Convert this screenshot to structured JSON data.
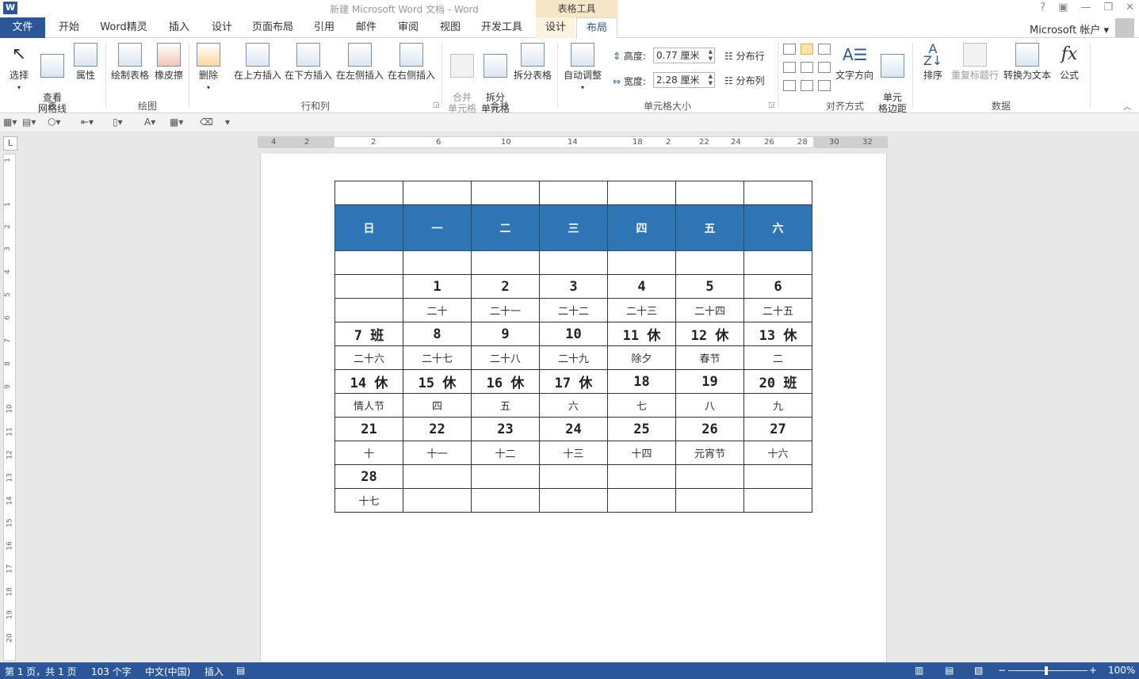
{
  "window": {
    "title": "新建 Microsoft Word 文档 - Word",
    "context_group": "表格工具",
    "controls": [
      "?",
      "▣",
      "—",
      "❐",
      "✕"
    ]
  },
  "tabs": [
    "文件",
    "开始",
    "Word精灵",
    "插入",
    "设计",
    "页面布局",
    "引用",
    "邮件",
    "审阅",
    "视图",
    "开发工具",
    "设计",
    "布局"
  ],
  "account": "Microsoft 帐户 ▾",
  "ribbon": {
    "table_group": {
      "label": "表",
      "select": "选择",
      "select_arrow": "▾",
      "gridlines": "查看\n网格线",
      "properties": "属性"
    },
    "draw_group": {
      "label": "绘图",
      "draw_table": "绘制表格",
      "eraser": "橡皮擦"
    },
    "rowcol_group": {
      "label": "行和列",
      "delete": "删除",
      "delete_arrow": "▾",
      "insert_above": "在上方插入",
      "insert_below": "在下方插入",
      "insert_left": "在左侧插入",
      "insert_right": "在右侧插入"
    },
    "merge_group": {
      "label": "合并",
      "merge_cells": "合并\n单元格",
      "split_cells": "拆分\n单元格",
      "split_table": "拆分表格"
    },
    "cellsize_group": {
      "label": "单元格大小",
      "autofit": "自动调整",
      "autofit_arrow": "▾",
      "height_label": "高度:",
      "height_value": "0.77 厘米",
      "width_label": "宽度:",
      "width_value": "2.28 厘米",
      "distribute_rows": "分布行",
      "distribute_cols": "分布列"
    },
    "align_group": {
      "label": "对齐方式",
      "text_direction": "文字方向",
      "cell_margins": "单元\n格边距"
    },
    "data_group": {
      "label": "数据",
      "sort": "排序",
      "repeat_header": "重复标题行",
      "convert_text": "转换为文本",
      "formula": "公式"
    }
  },
  "ruler": {
    "corner": "L",
    "h_ticks": [
      "4",
      "2",
      "2",
      "6",
      "10",
      "14",
      "18",
      "2",
      "22",
      "24",
      "26",
      "28",
      "30",
      "32"
    ],
    "v_ticks": [
      "1",
      "1",
      "2",
      "3",
      "4",
      "5",
      "6",
      "7",
      "8",
      "9",
      "10",
      "11",
      "12",
      "13",
      "14",
      "15",
      "16",
      "17",
      "18",
      "19",
      "20"
    ]
  },
  "calendar": {
    "headers": [
      "日",
      "一",
      "二",
      "三",
      "四",
      "五",
      "六"
    ],
    "rows": [
      {
        "type": "num",
        "cells": [
          "",
          "1",
          "2",
          "3",
          "4",
          "5",
          "6"
        ]
      },
      {
        "type": "lunar",
        "cells": [
          "",
          "二十",
          "二十一",
          "二十二",
          "二十三",
          "二十四",
          "二十五"
        ]
      },
      {
        "type": "num",
        "cells": [
          "7 班",
          "8",
          "9",
          "10",
          "11 休",
          "12 休",
          "13 休"
        ]
      },
      {
        "type": "lunar",
        "cells": [
          "二十六",
          "二十七",
          "二十八",
          "二十九",
          "除夕",
          "春节",
          "二"
        ]
      },
      {
        "type": "num",
        "cells": [
          "14 休",
          "15 休",
          "16 休",
          "17 休",
          "18",
          "19",
          "20 班"
        ]
      },
      {
        "type": "lunar",
        "cells": [
          "情人节",
          "四",
          "五",
          "六",
          "七",
          "八",
          "九"
        ]
      },
      {
        "type": "num",
        "cells": [
          "21",
          "22",
          "23",
          "24",
          "25",
          "26",
          "27"
        ]
      },
      {
        "type": "lunar",
        "cells": [
          "十",
          "十一",
          "十二",
          "十三",
          "十四",
          "元宵节",
          "十六"
        ]
      },
      {
        "type": "num",
        "cells": [
          "28",
          "",
          "",
          "",
          "",
          "",
          ""
        ]
      },
      {
        "type": "lunar",
        "cells": [
          "十七",
          "",
          "",
          "",
          "",
          "",
          ""
        ]
      }
    ]
  },
  "status": {
    "page": "第 1 页，共 1 页",
    "words": "103 个字",
    "language": "中文(中国)",
    "mode": "插入",
    "zoom": "100%",
    "zoom_level": 1.0
  },
  "colors": {
    "brand": "#2b579a",
    "table_header": "#2e75b6",
    "context_tab": "#f4e6c6"
  }
}
